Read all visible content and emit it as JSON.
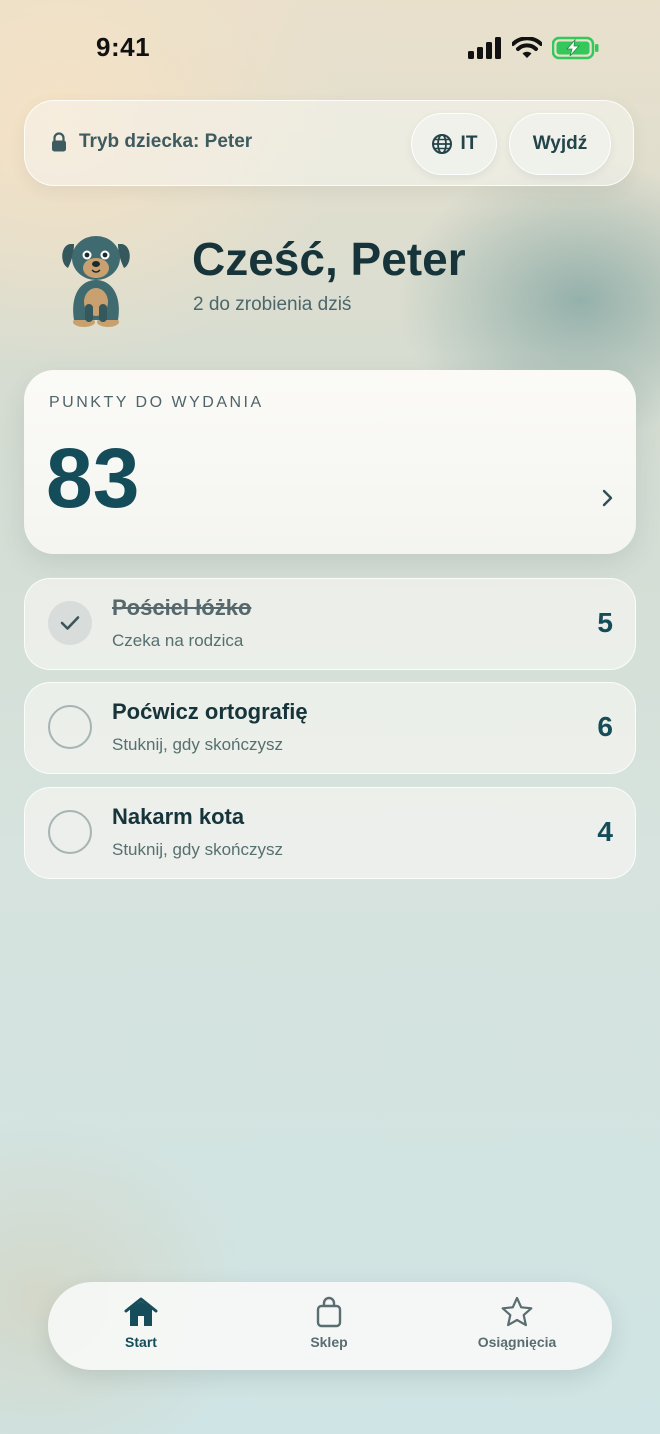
{
  "status_bar": {
    "time": "9:41"
  },
  "header": {
    "child_mode_label": "Tryb dziecka: Peter",
    "language_code": "IT",
    "exit_label": "Wyjdź"
  },
  "profile": {
    "greeting": "Cześć, Peter",
    "tasks_summary": "2 do zrobienia dziś"
  },
  "points": {
    "label": "PUNKTY DO WYDANIA",
    "value": "83"
  },
  "tasks": [
    {
      "title": "Pościel łóżko",
      "status": "Czeka na rodzica",
      "points": "5",
      "done": true
    },
    {
      "title": "Poćwicz ortografię",
      "status": "Stuknij, gdy skończysz",
      "points": "6",
      "done": false
    },
    {
      "title": "Nakarm kota",
      "status": "Stuknij, gdy skończysz",
      "points": "4",
      "done": false
    }
  ],
  "tab_bar": {
    "items": [
      {
        "label": "Start",
        "icon": "home-icon",
        "active": true
      },
      {
        "label": "Sklep",
        "icon": "shopping-bag-icon",
        "active": false
      },
      {
        "label": "Osiągnięcia",
        "icon": "star-icon",
        "active": false
      }
    ]
  },
  "colors": {
    "accent": "#154c5a",
    "battery": "#34c759"
  }
}
